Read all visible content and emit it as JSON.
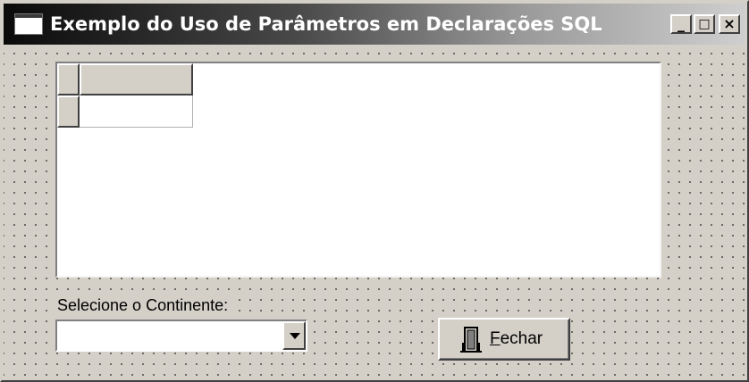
{
  "window": {
    "title": "Exemplo do Uso de Parâmetros em Declarações SQL",
    "controls": {
      "minimize": "_",
      "maximize": "□",
      "close": "×"
    }
  },
  "grid": {
    "columns": [
      ""
    ],
    "rows": [
      [
        ""
      ]
    ]
  },
  "continent": {
    "label": "Selecione o Continente:",
    "selected": ""
  },
  "close_button": {
    "accelerator": "F",
    "label_rest": "echar",
    "icon": "door-exit-icon"
  },
  "colors": {
    "face": "#d4d0c8",
    "title_start": "#0a0a0a",
    "title_end": "#cfcfcf"
  }
}
